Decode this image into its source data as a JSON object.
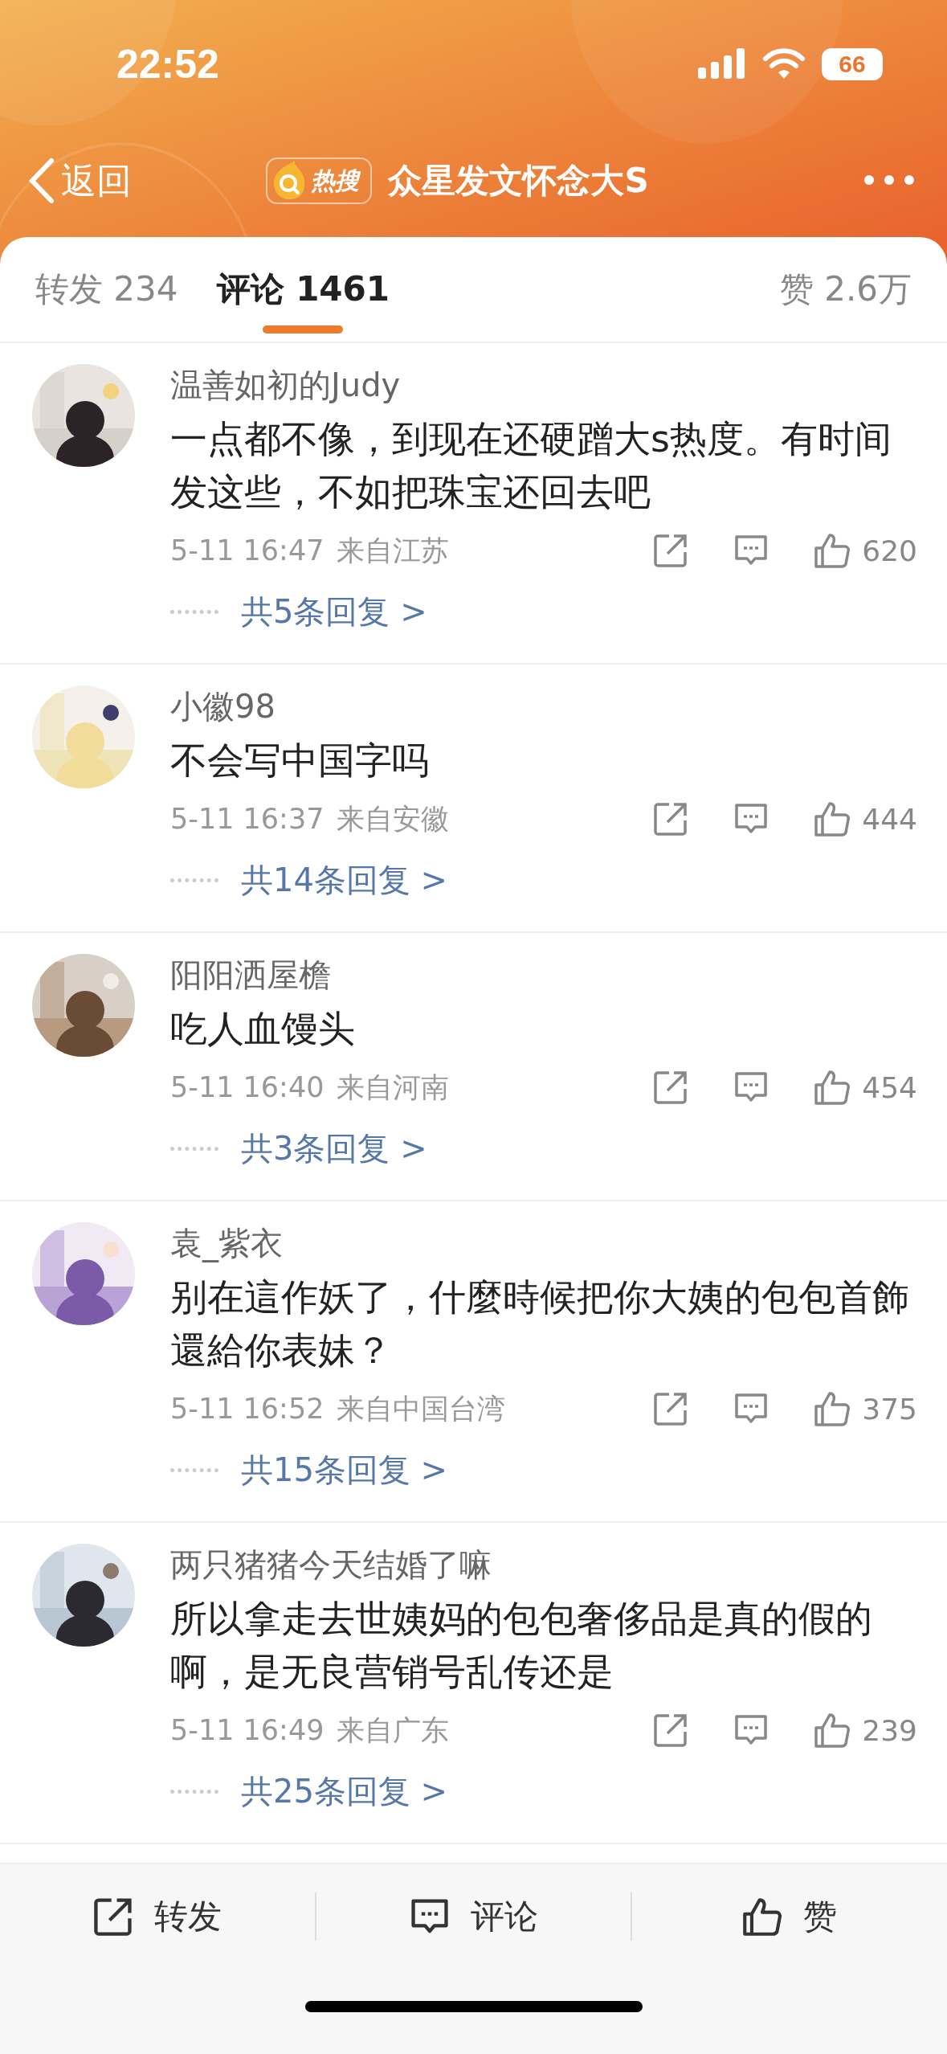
{
  "status_bar": {
    "time": "22:52",
    "battery": "66"
  },
  "nav": {
    "back": "返回",
    "badge": "热搜",
    "title": "众星发文怀念大S"
  },
  "tabs": [
    {
      "label": "转发 234",
      "selected": false
    },
    {
      "label": "评论 1461",
      "selected": true
    },
    {
      "label": "赞 2.6万",
      "selected": false
    }
  ],
  "comments": [
    {
      "user": "温善如初的Judy",
      "text": "一点都不像，到现在还硬蹭大s热度。有时间发这些，不如把珠宝还回去吧",
      "time": "5-11 16:47",
      "location": "来自江苏",
      "likes": "620",
      "replies": "共5条回复 >"
    },
    {
      "user": "小徽98",
      "text": "不会写中国字吗",
      "time": "5-11 16:37",
      "location": "来自安徽",
      "likes": "444",
      "replies": "共14条回复 >"
    },
    {
      "user": "阳阳洒屋檐",
      "text": "吃人血馒头",
      "time": "5-11 16:40",
      "location": "来自河南",
      "likes": "454",
      "replies": "共3条回复 >"
    },
    {
      "user": "袁_紫衣",
      "text": "别在這作妖了，什麼時候把你大姨的包包首飾還給你表妹？",
      "time": "5-11 16:52",
      "location": "来自中国台湾",
      "likes": "375",
      "replies": "共15条回复 >"
    },
    {
      "user": "两只猪猪今天结婚了嘛",
      "text": "所以拿走去世姨妈的包包奢侈品是真的假的啊，是无良营销号乱传还是",
      "time": "5-11 16:49",
      "location": "来自广东",
      "likes": "239",
      "replies": "共25条回复 >"
    }
  ],
  "actions": [
    {
      "kind": "share",
      "label": "转发"
    },
    {
      "kind": "comment",
      "label": "评论"
    },
    {
      "kind": "like",
      "label": "赞"
    }
  ]
}
